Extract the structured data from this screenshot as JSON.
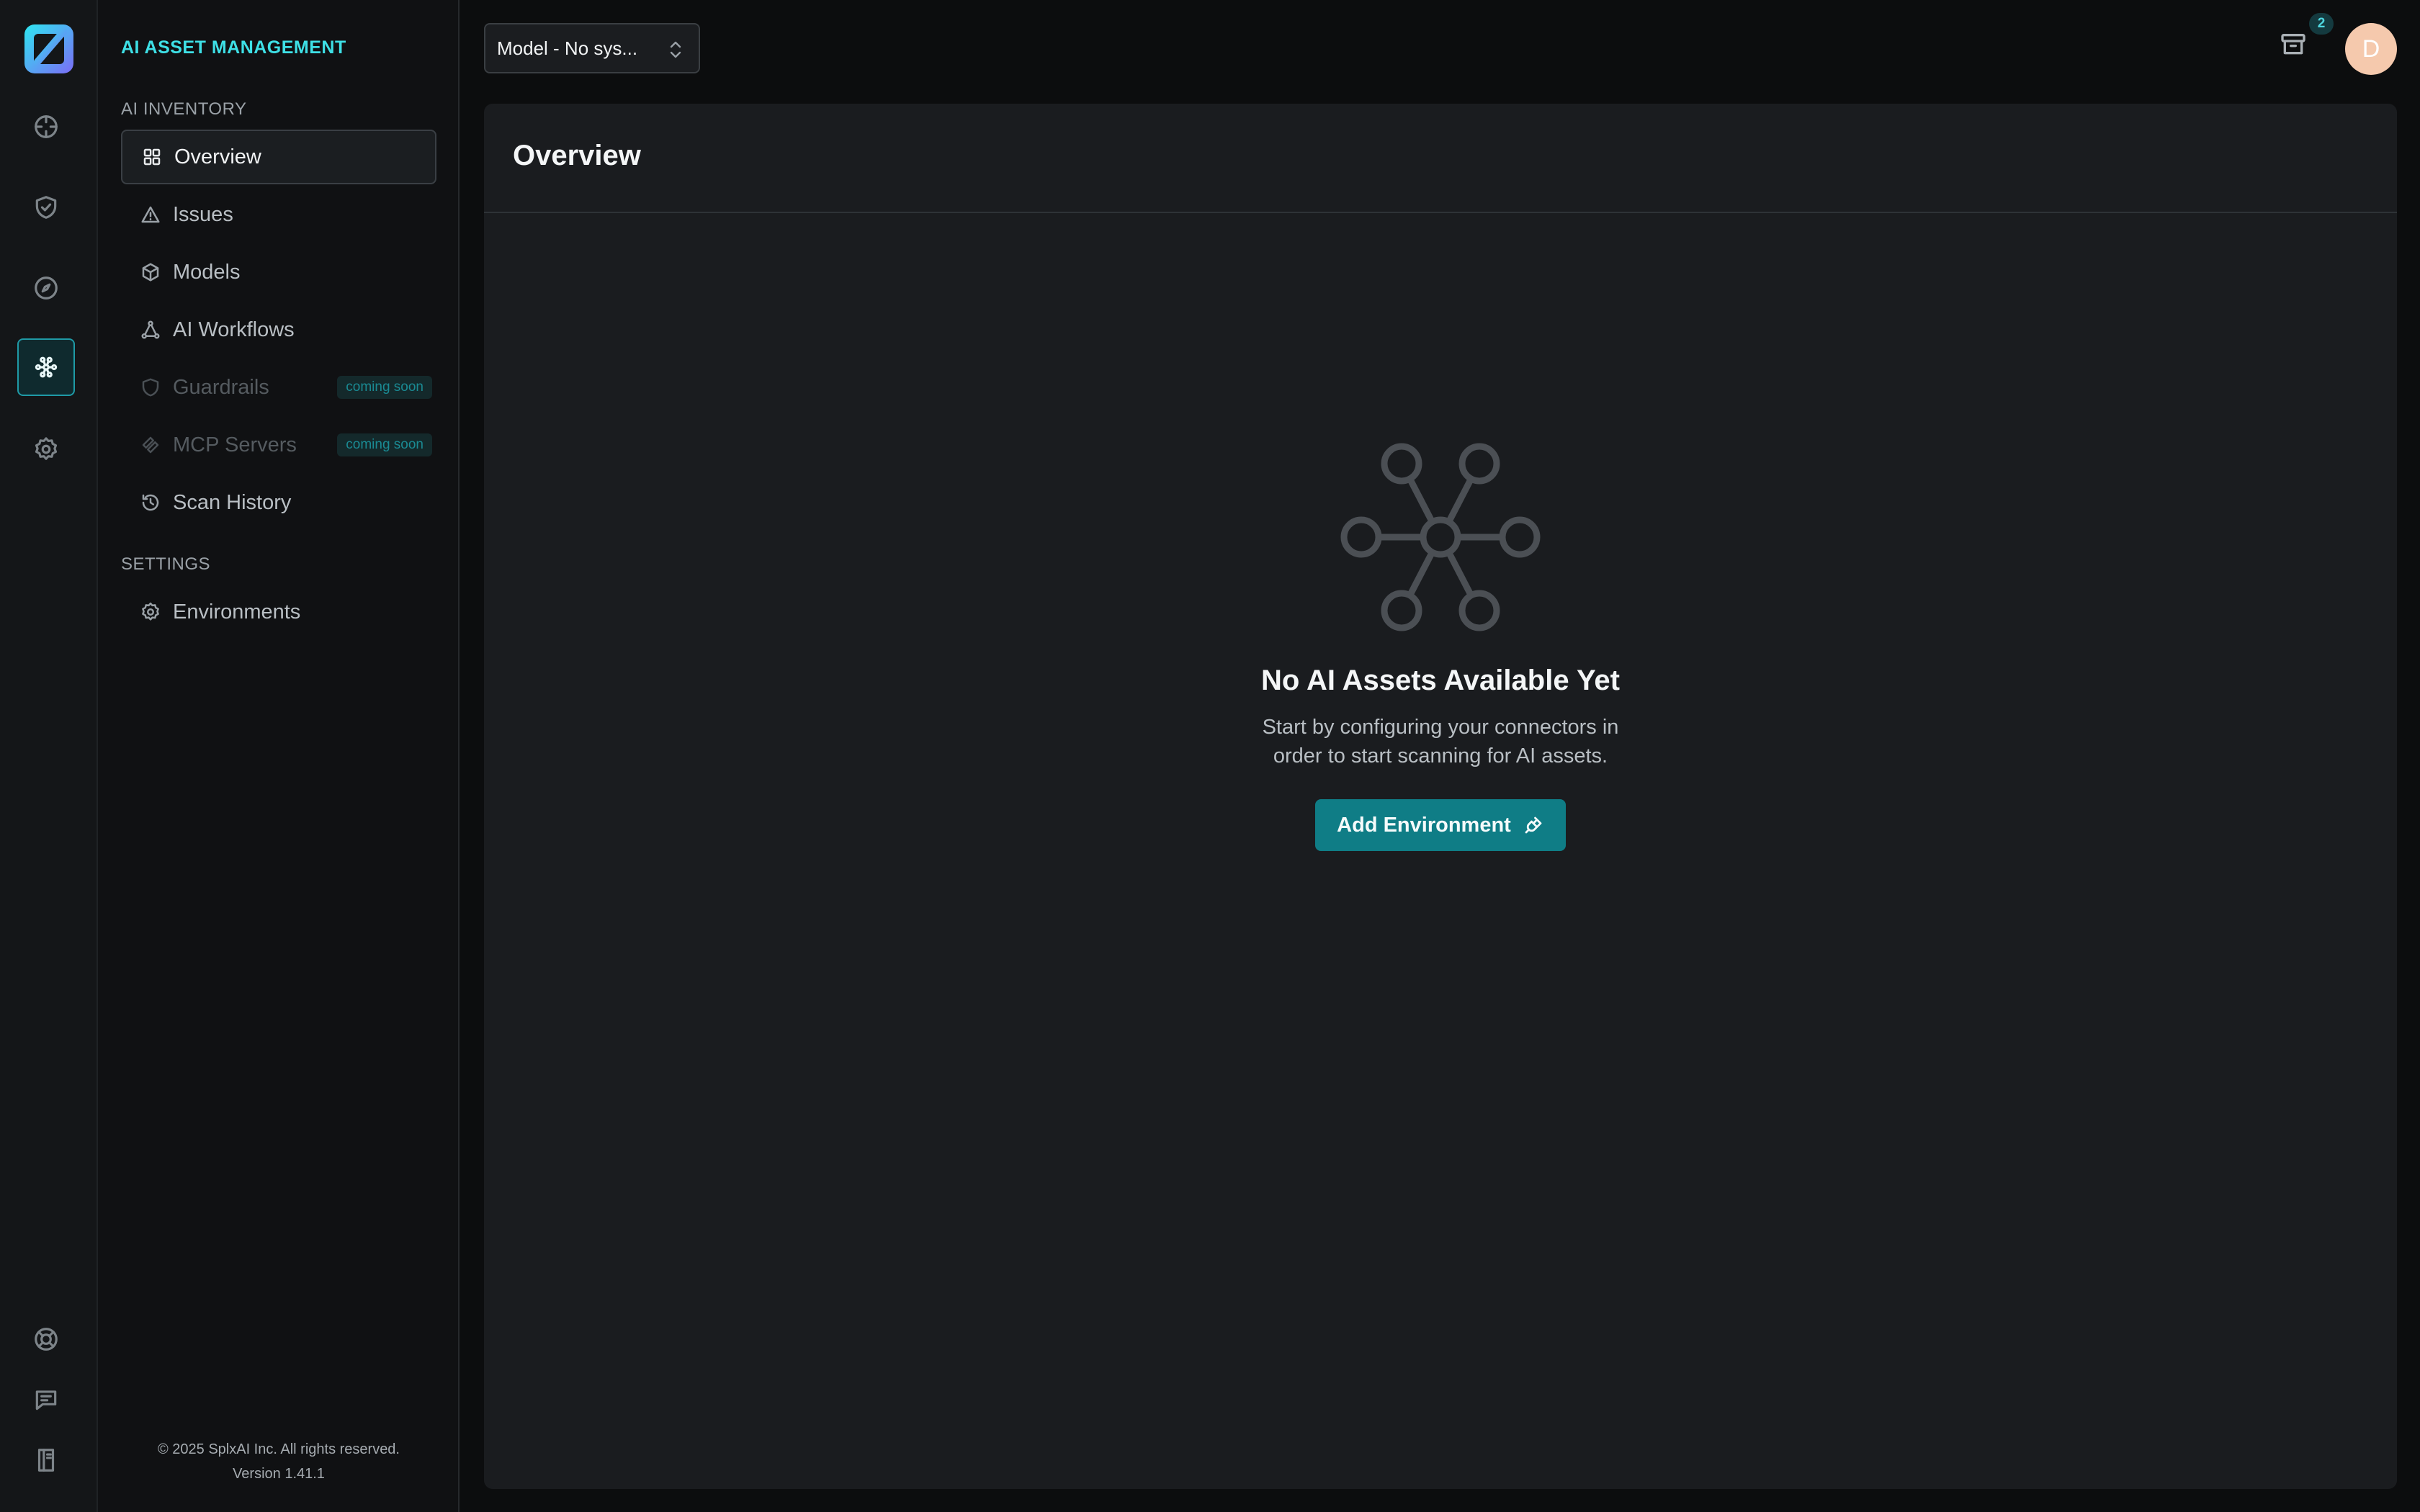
{
  "app": {
    "section_title": "AI ASSET MANAGEMENT",
    "accent_color": "#3ee0e6",
    "primary_button_color": "#0f7d86"
  },
  "rail": {
    "items": [
      {
        "icon": "crosshair-icon"
      },
      {
        "icon": "shield-check-icon"
      },
      {
        "icon": "compass-icon"
      },
      {
        "icon": "ai-network-icon",
        "active": true
      },
      {
        "icon": "gear-icon"
      }
    ],
    "bottom_items": [
      {
        "icon": "lifebuoy-icon"
      },
      {
        "icon": "message-icon"
      },
      {
        "icon": "book-icon"
      }
    ]
  },
  "sidebar": {
    "inventory_heading": "AI INVENTORY",
    "items": [
      {
        "label": "Overview",
        "icon": "grid-icon",
        "active": true
      },
      {
        "label": "Issues",
        "icon": "warning-triangle-icon"
      },
      {
        "label": "Models",
        "icon": "cube-icon"
      },
      {
        "label": "AI Workflows",
        "icon": "workflow-icon"
      },
      {
        "label": "Guardrails",
        "icon": "shield-icon",
        "badge": "coming soon",
        "disabled": true
      },
      {
        "label": "MCP Servers",
        "icon": "mcp-icon",
        "badge": "coming soon",
        "disabled": true
      },
      {
        "label": "Scan History",
        "icon": "history-icon"
      }
    ],
    "settings_heading": "SETTINGS",
    "settings_items": [
      {
        "label": "Environments",
        "icon": "gear-icon"
      }
    ],
    "footer": {
      "copyright": "© 2025 SplxAI Inc. All rights reserved.",
      "version": "Version 1.41.1"
    }
  },
  "topbar": {
    "model_select_value": "Model - No sys...",
    "notification_count": "2",
    "avatar_initial": "D"
  },
  "main": {
    "title": "Overview",
    "empty_state": {
      "title": "No AI Assets Available Yet",
      "description": "Start by configuring your connectors in order to start scanning for AI assets.",
      "button_label": "Add Environment"
    }
  }
}
